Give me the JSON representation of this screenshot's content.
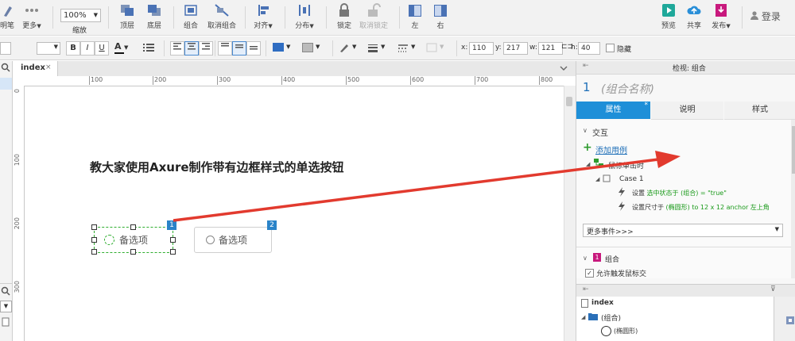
{
  "toolbar1": {
    "left_partial": "明笔",
    "more": "更多",
    "zoom_value": "100%",
    "zoom_label": "缩放",
    "top_layer": "顶层",
    "bottom_layer": "底层",
    "group": "组合",
    "ungroup": "取消组合",
    "align": "对齐",
    "distribute": "分布",
    "lock": "锁定",
    "unlock": "取消锁定",
    "left": "左",
    "right": "右",
    "preview": "预览",
    "share": "共享",
    "publish": "发布",
    "login": "登录"
  },
  "toolbar2": {
    "bold": "B",
    "italic": "I",
    "underline": "U",
    "font_color_letter": "A",
    "x_label": "x:",
    "x_value": "110",
    "y_label": "y:",
    "y_value": "217",
    "w_label": "w:",
    "w_value": "121",
    "h_label": "h:",
    "h_value": "40",
    "hide_label": "隐藏"
  },
  "canvas": {
    "tab_name": "index",
    "tab_close": "×",
    "ruler_top": [
      "100",
      "200",
      "300",
      "400",
      "500",
      "600",
      "700",
      "800"
    ],
    "ruler_left": [
      "0",
      "100",
      "200",
      "300"
    ],
    "heading": "教大家使用Axure制作带有边框样式的单选按钮",
    "radio1_label": "备选项",
    "radio1_badge": "1",
    "radio2_label": "备选项",
    "radio2_badge": "2"
  },
  "inspector": {
    "header": "检视: 组合",
    "number": "1",
    "name_placeholder": "(组合名称)",
    "tab_properties": "属性",
    "tab_notes": "说明",
    "tab_style": "样式",
    "section_interaction": "交互",
    "add_case": "添加用例",
    "event_onclick": "鼠标单击时",
    "case_name": "Case 1",
    "action1_prefix": "设置",
    "action1_detail": "选中状态于 (组合) = \"true\"",
    "action2_prefix": "设置尺寸于",
    "action2_detail": "(椭圆形) to 12 x 12 anchor 左上角",
    "more_events": "更多事件>>>",
    "group_badge": "1",
    "group_label": "组合",
    "allow_trigger": "允许触发鼠标交"
  },
  "outline": {
    "page": "index",
    "group": "(组合)",
    "ellipse": "(椭圆形)"
  },
  "colors": {
    "accent": "#1e8fd8",
    "badge_blue": "#2a83c8",
    "green": "#1a9a1a",
    "arrow_red": "#e23a2e",
    "magenta": "#c8197d"
  }
}
